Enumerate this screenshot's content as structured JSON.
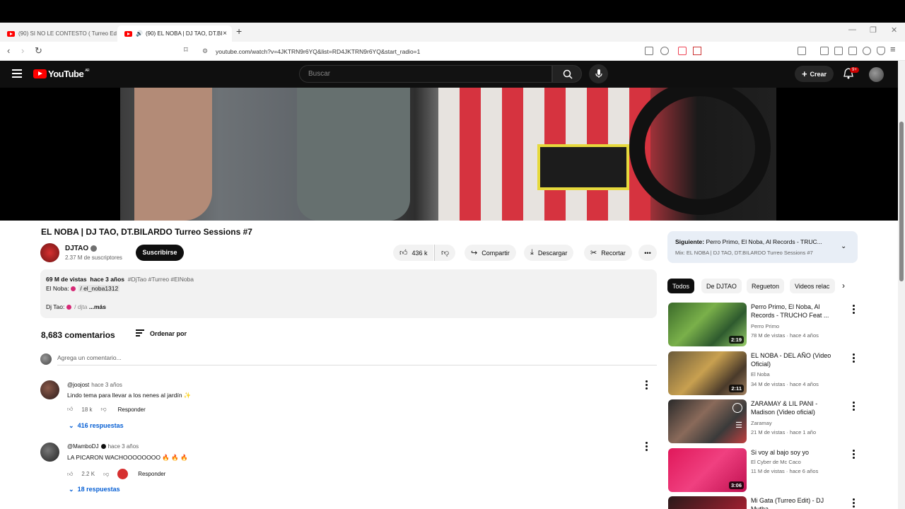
{
  "browser": {
    "tabs": [
      {
        "label": "(90) SI NO LE CONTESTO ( Turreo Ed"
      },
      {
        "label": "(90) EL NOBA | DJ TAO, DT.BI"
      }
    ],
    "new_tab": "+",
    "close": "×",
    "url": "youtube.com/watch?v=4JKTRN9r6YQ&list=RD4JKTRN9r6YQ&start_radio=1"
  },
  "header": {
    "logo_text": "YouTube",
    "region": "AR",
    "search_placeholder": "Buscar",
    "create_label": "Crear",
    "notif_badge": "9+"
  },
  "video": {
    "title": "EL NOBA | DJ TAO, DT.BILARDO Turreo Sessions #7",
    "channel": "DJTAO",
    "subscribers": "2.37 M de suscriptores",
    "subscribe_label": "Suscribirse",
    "likes": "436 k",
    "share_label": "Compartir",
    "download_label": "Descargar",
    "clip_label": "Recortar"
  },
  "description": {
    "views": "69 M de vistas",
    "age": "hace 3 años",
    "tags": "#DjTao #Turreo #ElNoba",
    "line2_label": "El Noba:",
    "line2_handle": "/ el_noba1312",
    "line3_label": "Dj Tao:",
    "line3_handle": "/ djta",
    "more": "...más"
  },
  "comments": {
    "count": "8,683 comentarios",
    "sort_label": "Ordenar por",
    "add_placeholder": "Agrega un comentario...",
    "items": [
      {
        "user": "@joojost",
        "time": "hace 3 años",
        "text": "Lindo tema para llevar a los nenes al jardín ✨",
        "likes": "18 k",
        "reply": "Responder",
        "replies": "416 respuestas"
      },
      {
        "user": "@MamboDJ",
        "time": "hace 3 años",
        "text": "LA PICARON WACHOOOOOOOO 🔥 🔥 🔥",
        "likes": "2.2 K",
        "reply": "Responder",
        "replies": "18 respuestas"
      }
    ]
  },
  "playlist": {
    "next_label": "Siguiente:",
    "next_title": "Perro Primo, El Noba, Al Records - TRUC...",
    "mix": "Mix: EL NOBA | DJ TAO, DT.BILARDO Turreo Sessions #7"
  },
  "chips": [
    "Todos",
    "De DJTAO",
    "Regueton",
    "Videos relac"
  ],
  "recommendations": [
    {
      "title": "Perro Primo, El Noba, Al Records - TRUCHO Feat ...",
      "channel": "Perro Primo",
      "meta": "78 M de vistas · hace 4 años",
      "duration": "2:19"
    },
    {
      "title": "EL NOBA - DEL AÑO (Video Oficial)",
      "channel": "El Noba",
      "meta": "34 M de vistas · hace 4 años",
      "duration": "2:11"
    },
    {
      "title": "ZARAMAY & LIL PANI - Madison (Video oficial)",
      "channel": "Zaramay",
      "meta": "21 M de vistas · hace 1 año",
      "duration": ""
    },
    {
      "title": "Si voy al bajo soy yo",
      "channel": "El Cyber de Mc Caco",
      "meta": "11 M de vistas · hace 6 años",
      "duration": "3:06"
    },
    {
      "title": "Mi Gata (Turreo Edit) - DJ Mutha",
      "channel": "",
      "meta": "",
      "duration": ""
    }
  ],
  "colors": {
    "accent": "#ff0000",
    "link": "#065fd4",
    "header_bg": "#0f0f0f"
  }
}
